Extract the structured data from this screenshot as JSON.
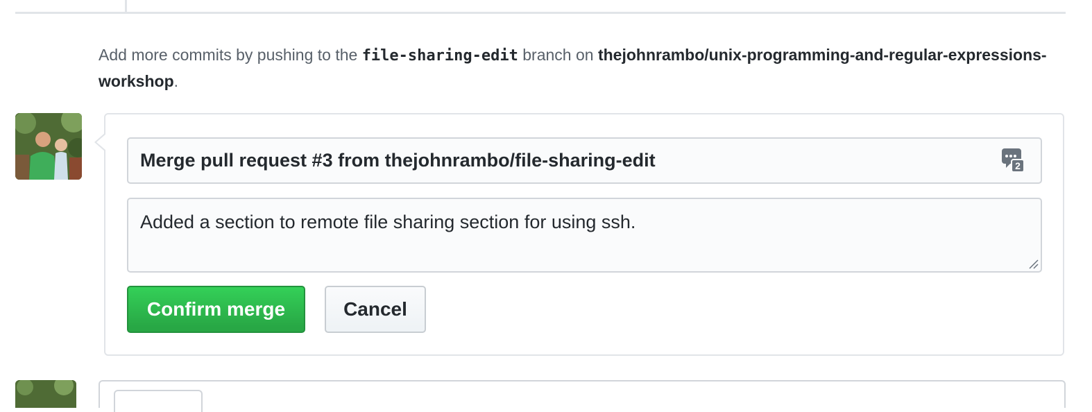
{
  "hint": {
    "prefix": "Add more commits by pushing to the ",
    "branch": "file-sharing-edit",
    "middle": " branch on ",
    "repo": "thejohnrambo/unix-programming-and-regular-expressions-workshop",
    "suffix": "."
  },
  "merge": {
    "title_value": "Merge pull request #3 from thejohnrambo/file-sharing-edit",
    "body_value": "Added a section to remote file sharing section for using ssh.",
    "saved_replies_badge": "2",
    "confirm_label": "Confirm merge",
    "cancel_label": "Cancel"
  },
  "colors": {
    "confirm_green": "#28a745",
    "border_gray": "#e1e4e8"
  }
}
